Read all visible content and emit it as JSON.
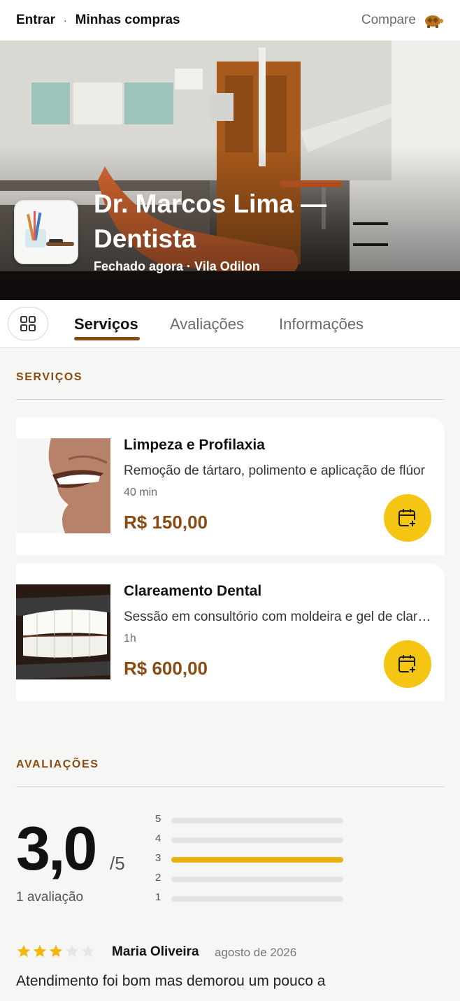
{
  "topbar": {
    "login": "Entrar",
    "purchases": "Minhas compras",
    "separator": "·",
    "compare": "Compare",
    "compare_icon": "turtle-icon"
  },
  "hero": {
    "title": "Dr. Marcos Lima — Dentista",
    "subtitle": "Fechado agora · Vila Odilon"
  },
  "tabs": [
    {
      "label": "Serviços",
      "active": true
    },
    {
      "label": "Avaliações",
      "active": false
    },
    {
      "label": "Informações",
      "active": false
    }
  ],
  "services": {
    "header": "SERVIÇOS",
    "items": [
      {
        "name": "Limpeza e Profilaxia",
        "description": "Remoção de tártaro, polimento e aplicação de flúor",
        "duration": "40 min",
        "price": "R$ 150,00",
        "action_icon": "calendar-plus-icon"
      },
      {
        "name": "Clareamento Dental",
        "description": "Sessão em consultório com moldeira e gel de clareamento",
        "duration": "1h",
        "price": "R$ 600,00",
        "action_icon": "calendar-plus-icon"
      }
    ]
  },
  "reviews": {
    "header": "AVALIAÇÕES",
    "average": "3,0",
    "scale": "/5",
    "count_label": "1 avaliação",
    "distribution": [
      {
        "stars": "5",
        "fraction": 0
      },
      {
        "stars": "4",
        "fraction": 0
      },
      {
        "stars": "3",
        "fraction": 1
      },
      {
        "stars": "2",
        "fraction": 0
      },
      {
        "stars": "1",
        "fraction": 0
      }
    ],
    "items": [
      {
        "rating": 3,
        "author": "Maria Oliveira",
        "date": "agosto de 2026",
        "text": "Atendimento foi bom mas demorou um pouco a"
      }
    ]
  },
  "colors": {
    "accent": "#8a4b12",
    "button": "#f4c513",
    "bar": "#ebb112",
    "star_on": "#f2b80c",
    "star_off": "#e6e6e6"
  }
}
